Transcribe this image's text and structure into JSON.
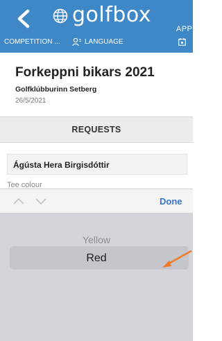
{
  "header": {
    "logo_word": "golfbox",
    "logo_app": "APP",
    "nav": {
      "competition": "COMPETITION ...",
      "language": "LANGUAGE"
    }
  },
  "event": {
    "title": "Forkeppni bikars 2021",
    "club": "Golfklúbburinn Setberg",
    "date": "26/5/2021"
  },
  "section": {
    "requests": "REQUESTS"
  },
  "player": {
    "name": "Ágústa Hera Birgisdóttir",
    "next_label_partial": "Tee colour"
  },
  "accessory": {
    "done": "Done"
  },
  "picker": {
    "options": [
      "Yellow",
      "Red"
    ],
    "selected": "Red"
  },
  "colors": {
    "header_bg": "#3f88c8",
    "accent": "#3575c8",
    "arrow": "#f07a2a"
  }
}
